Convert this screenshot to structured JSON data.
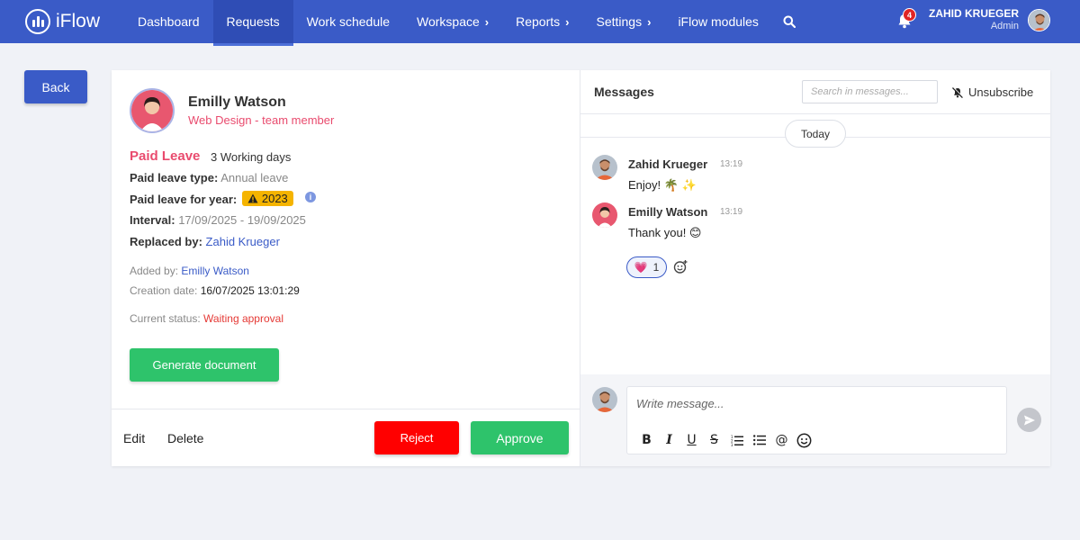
{
  "app": {
    "name": "iFlow"
  },
  "nav": {
    "items": [
      {
        "label": "Dashboard",
        "chevron": false
      },
      {
        "label": "Requests",
        "chevron": false,
        "active": true
      },
      {
        "label": "Work schedule",
        "chevron": false
      },
      {
        "label": "Workspace",
        "chevron": true
      },
      {
        "label": "Reports",
        "chevron": true
      },
      {
        "label": "Settings",
        "chevron": true
      },
      {
        "label": "iFlow modules",
        "chevron": false
      }
    ],
    "search_icon": "search-icon"
  },
  "header": {
    "notification_count": "4",
    "user_name": "ZAHID KRUEGER",
    "user_role": "Admin"
  },
  "back_label": "Back",
  "request": {
    "employee_name": "Emilly Watson",
    "employee_role": "Web Design - team member",
    "leave_type_title": "Paid Leave",
    "working_days": "3 Working days",
    "paid_leave_type_label": "Paid leave type:",
    "paid_leave_type_value": "Annual leave",
    "paid_leave_year_label": "Paid leave for year:",
    "paid_leave_year_value": "2023",
    "interval_label": "Interval:",
    "interval_value": "17/09/2025 - 19/09/2025",
    "replaced_by_label": "Replaced by:",
    "replaced_by_value": "Zahid Krueger",
    "added_by_label": "Added by:",
    "added_by_value": "Emilly Watson",
    "creation_date_label": "Creation date:",
    "creation_date_value": "16/07/2025 13:01:29",
    "status_label": "Current status:",
    "status_value": "Waiting approval",
    "generate_label": "Generate document",
    "edit_label": "Edit",
    "delete_label": "Delete",
    "reject_label": "Reject",
    "approve_label": "Approve"
  },
  "messages": {
    "title": "Messages",
    "search_placeholder": "Search in messages...",
    "unsubscribe_label": "Unsubscribe",
    "date_divider": "Today",
    "items": [
      {
        "author": "Zahid Krueger",
        "time": "13:19",
        "text": "Enjoy! 🌴 ✨"
      },
      {
        "author": "Emilly Watson",
        "time": "13:19",
        "text": "Thank you! 😊"
      }
    ],
    "reaction": {
      "emoji": "💗",
      "count": "1"
    },
    "composer_placeholder": "Write message...",
    "toolbar": [
      "B",
      "I",
      "U",
      "S",
      "ordered-list",
      "bullet-list",
      "@",
      "emoji"
    ]
  },
  "colors": {
    "brand": "#3a5bc7",
    "accent_pink": "#e94b6e",
    "success": "#2ec36b",
    "danger": "#ff0000",
    "warning": "#f5b400"
  }
}
